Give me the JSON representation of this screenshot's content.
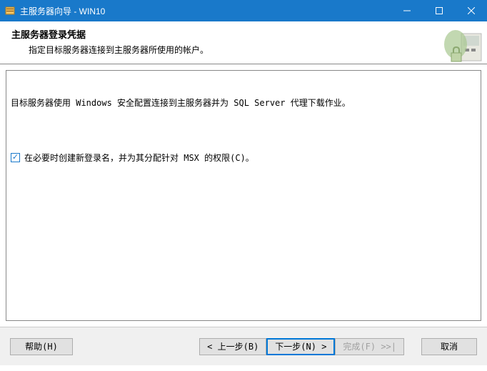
{
  "titlebar": {
    "title": "主服务器向导 - WIN10"
  },
  "header": {
    "title": "主服务器登录凭据",
    "subtitle": "指定目标服务器连接到主服务器所使用的帐户。"
  },
  "content": {
    "description": "目标服务器使用 Windows 安全配置连接到主服务器并为 SQL Server 代理下载作业。",
    "checkbox_label": "在必要时创建新登录名，并为其分配针对 MSX 的权限(C)。",
    "checkbox_checked": true
  },
  "buttons": {
    "help": "帮助(H)",
    "back": "< 上一步(B)",
    "next_text": "下一步(N) >",
    "finish": "完成(F) >>|",
    "cancel": "取消"
  }
}
